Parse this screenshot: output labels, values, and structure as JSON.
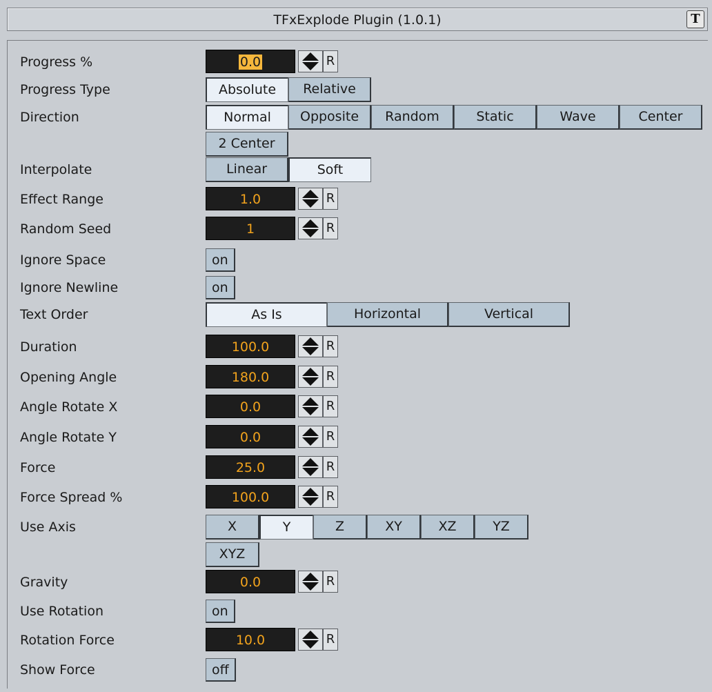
{
  "title": "TFxExplode Plugin (1.0.1)",
  "logo_text": "T",
  "progress": {
    "label": "Progress %",
    "value": "0.0",
    "reset": "R"
  },
  "progress_type": {
    "label": "Progress Type",
    "options": [
      "Absolute",
      "Relative"
    ],
    "selected": "Absolute"
  },
  "direction": {
    "label": "Direction",
    "options": [
      "Normal",
      "Opposite",
      "Random",
      "Static",
      "Wave",
      "Center",
      "2 Center"
    ],
    "selected": "Normal"
  },
  "interpolate": {
    "label": "Interpolate",
    "options": [
      "Linear",
      "Soft"
    ],
    "selected": "Soft"
  },
  "effect_range": {
    "label": "Effect Range",
    "value": "1.0",
    "reset": "R"
  },
  "random_seed": {
    "label": "Random Seed",
    "value": "1",
    "reset": "R"
  },
  "ignore_space": {
    "label": "Ignore Space",
    "value": "on"
  },
  "ignore_newline": {
    "label": "Ignore Newline",
    "value": "on"
  },
  "text_order": {
    "label": "Text Order",
    "options": [
      "As Is",
      "Horizontal",
      "Vertical"
    ],
    "selected": "As Is"
  },
  "duration": {
    "label": "Duration",
    "value": "100.0",
    "reset": "R"
  },
  "opening_angle": {
    "label": "Opening Angle",
    "value": "180.0",
    "reset": "R"
  },
  "angle_rotate_x": {
    "label": "Angle Rotate X",
    "value": "0.0",
    "reset": "R"
  },
  "angle_rotate_y": {
    "label": "Angle Rotate Y",
    "value": "0.0",
    "reset": "R"
  },
  "force": {
    "label": "Force",
    "value": "25.0",
    "reset": "R"
  },
  "force_spread": {
    "label": "Force Spread %",
    "value": "100.0",
    "reset": "R"
  },
  "use_axis": {
    "label": "Use Axis",
    "options": [
      "X",
      "Y",
      "Z",
      "XY",
      "XZ",
      "YZ",
      "XYZ"
    ],
    "selected": "Y"
  },
  "gravity": {
    "label": "Gravity",
    "value": "0.0",
    "reset": "R"
  },
  "use_rotation": {
    "label": "Use Rotation",
    "value": "on"
  },
  "rotation_force": {
    "label": "Rotation Force",
    "value": "10.0",
    "reset": "R"
  },
  "show_force": {
    "label": "Show Force",
    "value": "off"
  },
  "colors": {
    "background": "#c9cdd2",
    "field_bg": "#1d1d1d",
    "field_text": "#f2a31d",
    "button": "#b8c7d3",
    "button_selected": "#eaf0f7"
  }
}
